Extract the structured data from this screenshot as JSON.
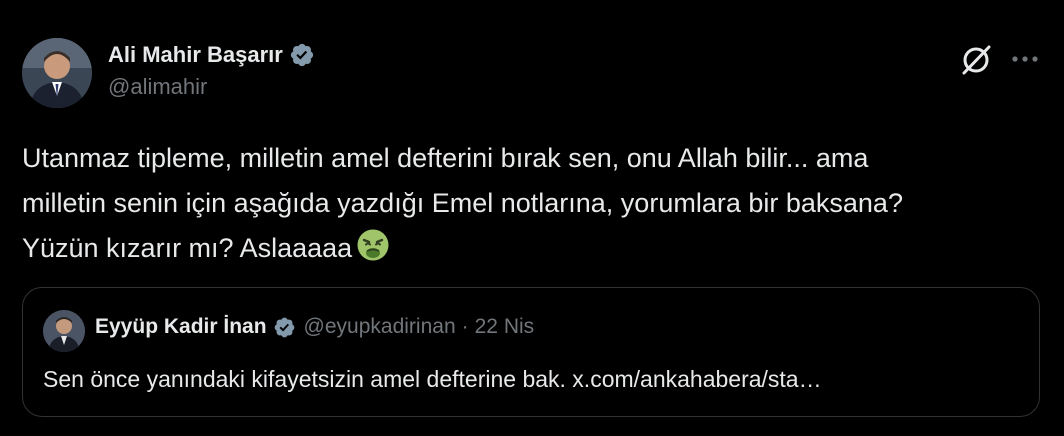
{
  "tweet": {
    "author": {
      "name": "Ali Mahir Başarır",
      "handle": "@alimahir",
      "verified": true
    },
    "text": "Utanmaz tipleme,  milletin amel defterini bırak sen, onu Allah bilir... ama\nmilletin senin için aşağıda yazdığı Emel notlarına, yorumlara bir baksana?\nYüzün kızarır mı? Aslaaaaa",
    "emoji": "nauseated-face",
    "icons": {
      "grok": "grok-icon",
      "more": "more-icon",
      "verified": "verified-badge-icon"
    }
  },
  "quoted_tweet": {
    "author": {
      "name": "Eyyüp Kadir İnan",
      "handle": "@eyupkadirinan",
      "verified": true
    },
    "separator": "·",
    "date": "22 Nis",
    "text": "Sen önce yanındaki kifayetsizin amel defterine bak. x.com/ankahabera/sta…"
  },
  "colors": {
    "background": "#000000",
    "primary_text": "#e7e9ea",
    "secondary_text": "#71767b",
    "border": "#2f3336",
    "verified_badge": "#829aab"
  }
}
